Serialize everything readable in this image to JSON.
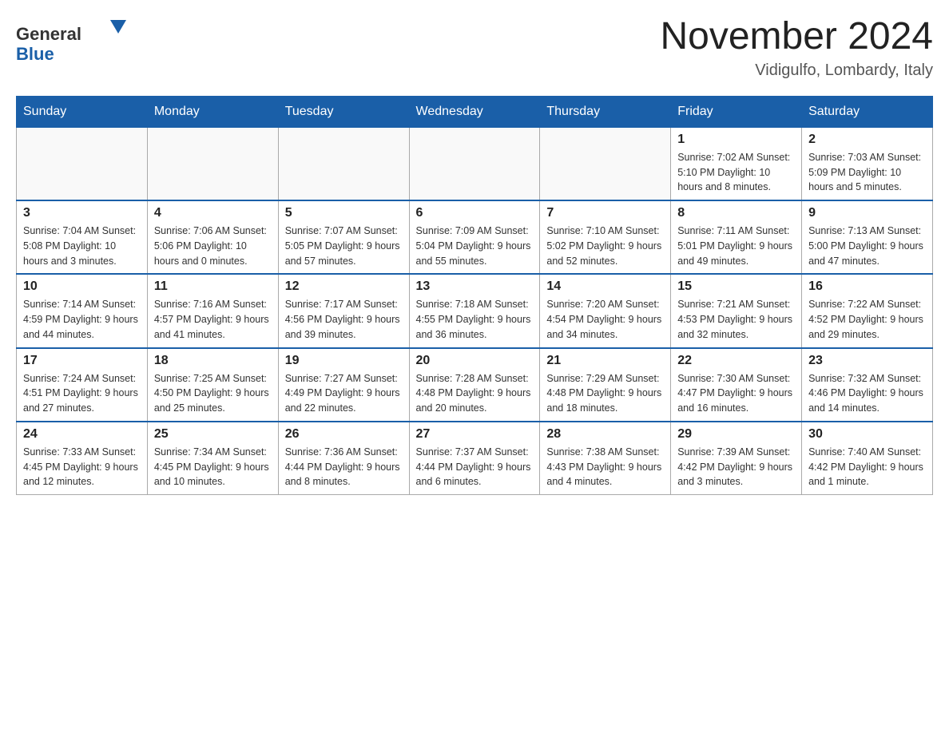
{
  "header": {
    "logo_general": "General",
    "logo_blue": "Blue",
    "month_title": "November 2024",
    "location": "Vidigulfo, Lombardy, Italy"
  },
  "weekdays": [
    "Sunday",
    "Monday",
    "Tuesday",
    "Wednesday",
    "Thursday",
    "Friday",
    "Saturday"
  ],
  "weeks": [
    {
      "days": [
        {
          "number": "",
          "info": ""
        },
        {
          "number": "",
          "info": ""
        },
        {
          "number": "",
          "info": ""
        },
        {
          "number": "",
          "info": ""
        },
        {
          "number": "",
          "info": ""
        },
        {
          "number": "1",
          "info": "Sunrise: 7:02 AM\nSunset: 5:10 PM\nDaylight: 10 hours and 8 minutes."
        },
        {
          "number": "2",
          "info": "Sunrise: 7:03 AM\nSunset: 5:09 PM\nDaylight: 10 hours and 5 minutes."
        }
      ]
    },
    {
      "days": [
        {
          "number": "3",
          "info": "Sunrise: 7:04 AM\nSunset: 5:08 PM\nDaylight: 10 hours and 3 minutes."
        },
        {
          "number": "4",
          "info": "Sunrise: 7:06 AM\nSunset: 5:06 PM\nDaylight: 10 hours and 0 minutes."
        },
        {
          "number": "5",
          "info": "Sunrise: 7:07 AM\nSunset: 5:05 PM\nDaylight: 9 hours and 57 minutes."
        },
        {
          "number": "6",
          "info": "Sunrise: 7:09 AM\nSunset: 5:04 PM\nDaylight: 9 hours and 55 minutes."
        },
        {
          "number": "7",
          "info": "Sunrise: 7:10 AM\nSunset: 5:02 PM\nDaylight: 9 hours and 52 minutes."
        },
        {
          "number": "8",
          "info": "Sunrise: 7:11 AM\nSunset: 5:01 PM\nDaylight: 9 hours and 49 minutes."
        },
        {
          "number": "9",
          "info": "Sunrise: 7:13 AM\nSunset: 5:00 PM\nDaylight: 9 hours and 47 minutes."
        }
      ]
    },
    {
      "days": [
        {
          "number": "10",
          "info": "Sunrise: 7:14 AM\nSunset: 4:59 PM\nDaylight: 9 hours and 44 minutes."
        },
        {
          "number": "11",
          "info": "Sunrise: 7:16 AM\nSunset: 4:57 PM\nDaylight: 9 hours and 41 minutes."
        },
        {
          "number": "12",
          "info": "Sunrise: 7:17 AM\nSunset: 4:56 PM\nDaylight: 9 hours and 39 minutes."
        },
        {
          "number": "13",
          "info": "Sunrise: 7:18 AM\nSunset: 4:55 PM\nDaylight: 9 hours and 36 minutes."
        },
        {
          "number": "14",
          "info": "Sunrise: 7:20 AM\nSunset: 4:54 PM\nDaylight: 9 hours and 34 minutes."
        },
        {
          "number": "15",
          "info": "Sunrise: 7:21 AM\nSunset: 4:53 PM\nDaylight: 9 hours and 32 minutes."
        },
        {
          "number": "16",
          "info": "Sunrise: 7:22 AM\nSunset: 4:52 PM\nDaylight: 9 hours and 29 minutes."
        }
      ]
    },
    {
      "days": [
        {
          "number": "17",
          "info": "Sunrise: 7:24 AM\nSunset: 4:51 PM\nDaylight: 9 hours and 27 minutes."
        },
        {
          "number": "18",
          "info": "Sunrise: 7:25 AM\nSunset: 4:50 PM\nDaylight: 9 hours and 25 minutes."
        },
        {
          "number": "19",
          "info": "Sunrise: 7:27 AM\nSunset: 4:49 PM\nDaylight: 9 hours and 22 minutes."
        },
        {
          "number": "20",
          "info": "Sunrise: 7:28 AM\nSunset: 4:48 PM\nDaylight: 9 hours and 20 minutes."
        },
        {
          "number": "21",
          "info": "Sunrise: 7:29 AM\nSunset: 4:48 PM\nDaylight: 9 hours and 18 minutes."
        },
        {
          "number": "22",
          "info": "Sunrise: 7:30 AM\nSunset: 4:47 PM\nDaylight: 9 hours and 16 minutes."
        },
        {
          "number": "23",
          "info": "Sunrise: 7:32 AM\nSunset: 4:46 PM\nDaylight: 9 hours and 14 minutes."
        }
      ]
    },
    {
      "days": [
        {
          "number": "24",
          "info": "Sunrise: 7:33 AM\nSunset: 4:45 PM\nDaylight: 9 hours and 12 minutes."
        },
        {
          "number": "25",
          "info": "Sunrise: 7:34 AM\nSunset: 4:45 PM\nDaylight: 9 hours and 10 minutes."
        },
        {
          "number": "26",
          "info": "Sunrise: 7:36 AM\nSunset: 4:44 PM\nDaylight: 9 hours and 8 minutes."
        },
        {
          "number": "27",
          "info": "Sunrise: 7:37 AM\nSunset: 4:44 PM\nDaylight: 9 hours and 6 minutes."
        },
        {
          "number": "28",
          "info": "Sunrise: 7:38 AM\nSunset: 4:43 PM\nDaylight: 9 hours and 4 minutes."
        },
        {
          "number": "29",
          "info": "Sunrise: 7:39 AM\nSunset: 4:42 PM\nDaylight: 9 hours and 3 minutes."
        },
        {
          "number": "30",
          "info": "Sunrise: 7:40 AM\nSunset: 4:42 PM\nDaylight: 9 hours and 1 minute."
        }
      ]
    }
  ]
}
